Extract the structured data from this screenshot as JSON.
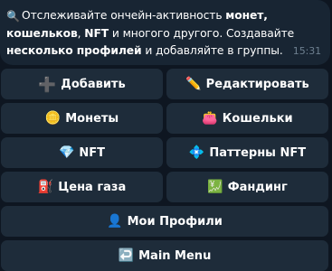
{
  "message": {
    "line1_pre": "Отслеживайте ончейн-активность ",
    "line1_bold": "монет,",
    "line2_bold_a": "кошельков",
    "line2_mid": ", ",
    "line2_bold_b": "NFT",
    "line2_post": " и многого другого. Создавайте",
    "line3_bold": "несколько профилей",
    "line3_post": " и добавляйте в группы.",
    "time": "15:31"
  },
  "keyboard": {
    "add": "Добавить",
    "edit": "Редактировать",
    "coins": "Монеты",
    "wallets": "Кошельки",
    "nft": "NFT",
    "nft_patterns": "Паттерны NFT",
    "gas_price": "Цена газа",
    "funding": "Фандинг",
    "my_profiles": "Мои Профили",
    "main_menu": "Main Menu"
  },
  "icons": {
    "search": "search-icon",
    "add": "plus-icon",
    "edit": "pencil-icon",
    "coins": "coin-icon",
    "wallets": "purse-icon",
    "nft": "gem-icon",
    "nft_patterns": "diamond-pattern-icon",
    "gas_price": "fuel-pump-icon",
    "funding": "chart-icon",
    "my_profiles": "profile-icon",
    "main_menu": "return-arrow-icon"
  },
  "colors": {
    "background": "#0e1621",
    "bubble": "#182533",
    "button": "#1e2c3a",
    "time": "#6d7f8f"
  }
}
